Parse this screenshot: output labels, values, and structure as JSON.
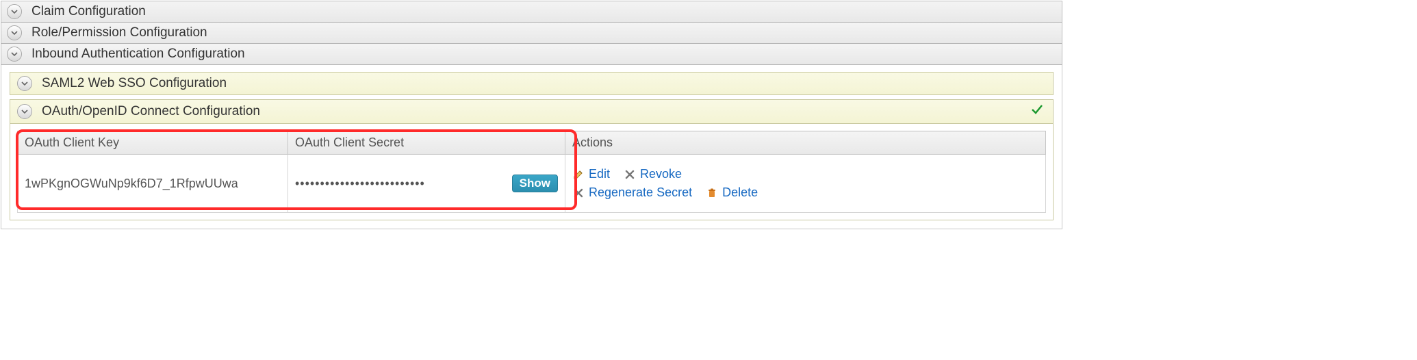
{
  "sections": {
    "claim": {
      "label": "Claim Configuration"
    },
    "role": {
      "label": "Role/Permission Configuration"
    },
    "inbound": {
      "label": "Inbound Authentication Configuration"
    }
  },
  "sub_sections": {
    "saml": {
      "label": "SAML2 Web SSO Configuration"
    },
    "oauth": {
      "label": "OAuth/OpenID Connect Configuration",
      "configured": true
    }
  },
  "oauth_table": {
    "headers": {
      "key": "OAuth Client Key",
      "secret": "OAuth Client Secret",
      "actions": "Actions"
    },
    "row": {
      "client_key": "1wPKgnOGWuNp9kf6D7_1RfpwUUwa",
      "client_secret_masked": "••••••••••••••••••••••••••",
      "show_label": "Show"
    },
    "actions": {
      "edit": "Edit",
      "revoke": "Revoke",
      "regen": "Regenerate Secret",
      "delete": "Delete"
    }
  }
}
